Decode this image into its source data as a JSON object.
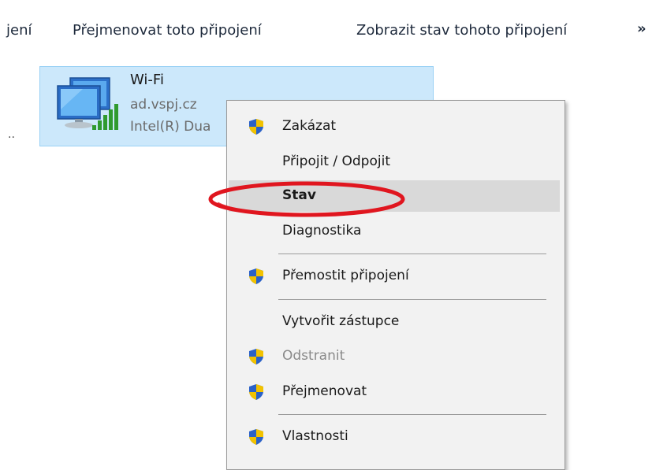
{
  "toolbar": {
    "item_cut": "jení",
    "item_rename": "Přejmenovat toto připojení",
    "item_status": "Zobrazit stav tohoto připojení",
    "overflow": "»"
  },
  "stray": {
    "dots": ".."
  },
  "connection": {
    "name": "Wi-Fi",
    "network": "ad.vspj.cz",
    "adapter": "Intel(R) Dua",
    "icon": "network-adapter-wifi-icon"
  },
  "menu": {
    "items": [
      {
        "label": "Zakázat",
        "shield": true,
        "state": "normal"
      },
      {
        "label": "Připojit / Odpojit",
        "shield": false,
        "state": "normal"
      },
      {
        "label": "Stav",
        "shield": false,
        "state": "highlighted-bold"
      },
      {
        "label": "Diagnostika",
        "shield": false,
        "state": "normal"
      },
      {
        "label": "Přemostit připojení",
        "shield": true,
        "state": "normal"
      },
      {
        "label": "Vytvořit zástupce",
        "shield": false,
        "state": "normal"
      },
      {
        "label": "Odstranit",
        "shield": true,
        "state": "disabled"
      },
      {
        "label": "Přejmenovat",
        "shield": true,
        "state": "normal"
      },
      {
        "label": "Vlastnosti",
        "shield": true,
        "state": "normal"
      }
    ]
  },
  "colors": {
    "tile_bg": "#cce8fb",
    "tile_border": "#99d1f5",
    "menu_bg": "#f2f2f2",
    "menu_hover": "#d9d9d9",
    "annotation": "#e0161f",
    "shield_blue": "#2b62c8",
    "shield_yellow": "#f2c200"
  }
}
